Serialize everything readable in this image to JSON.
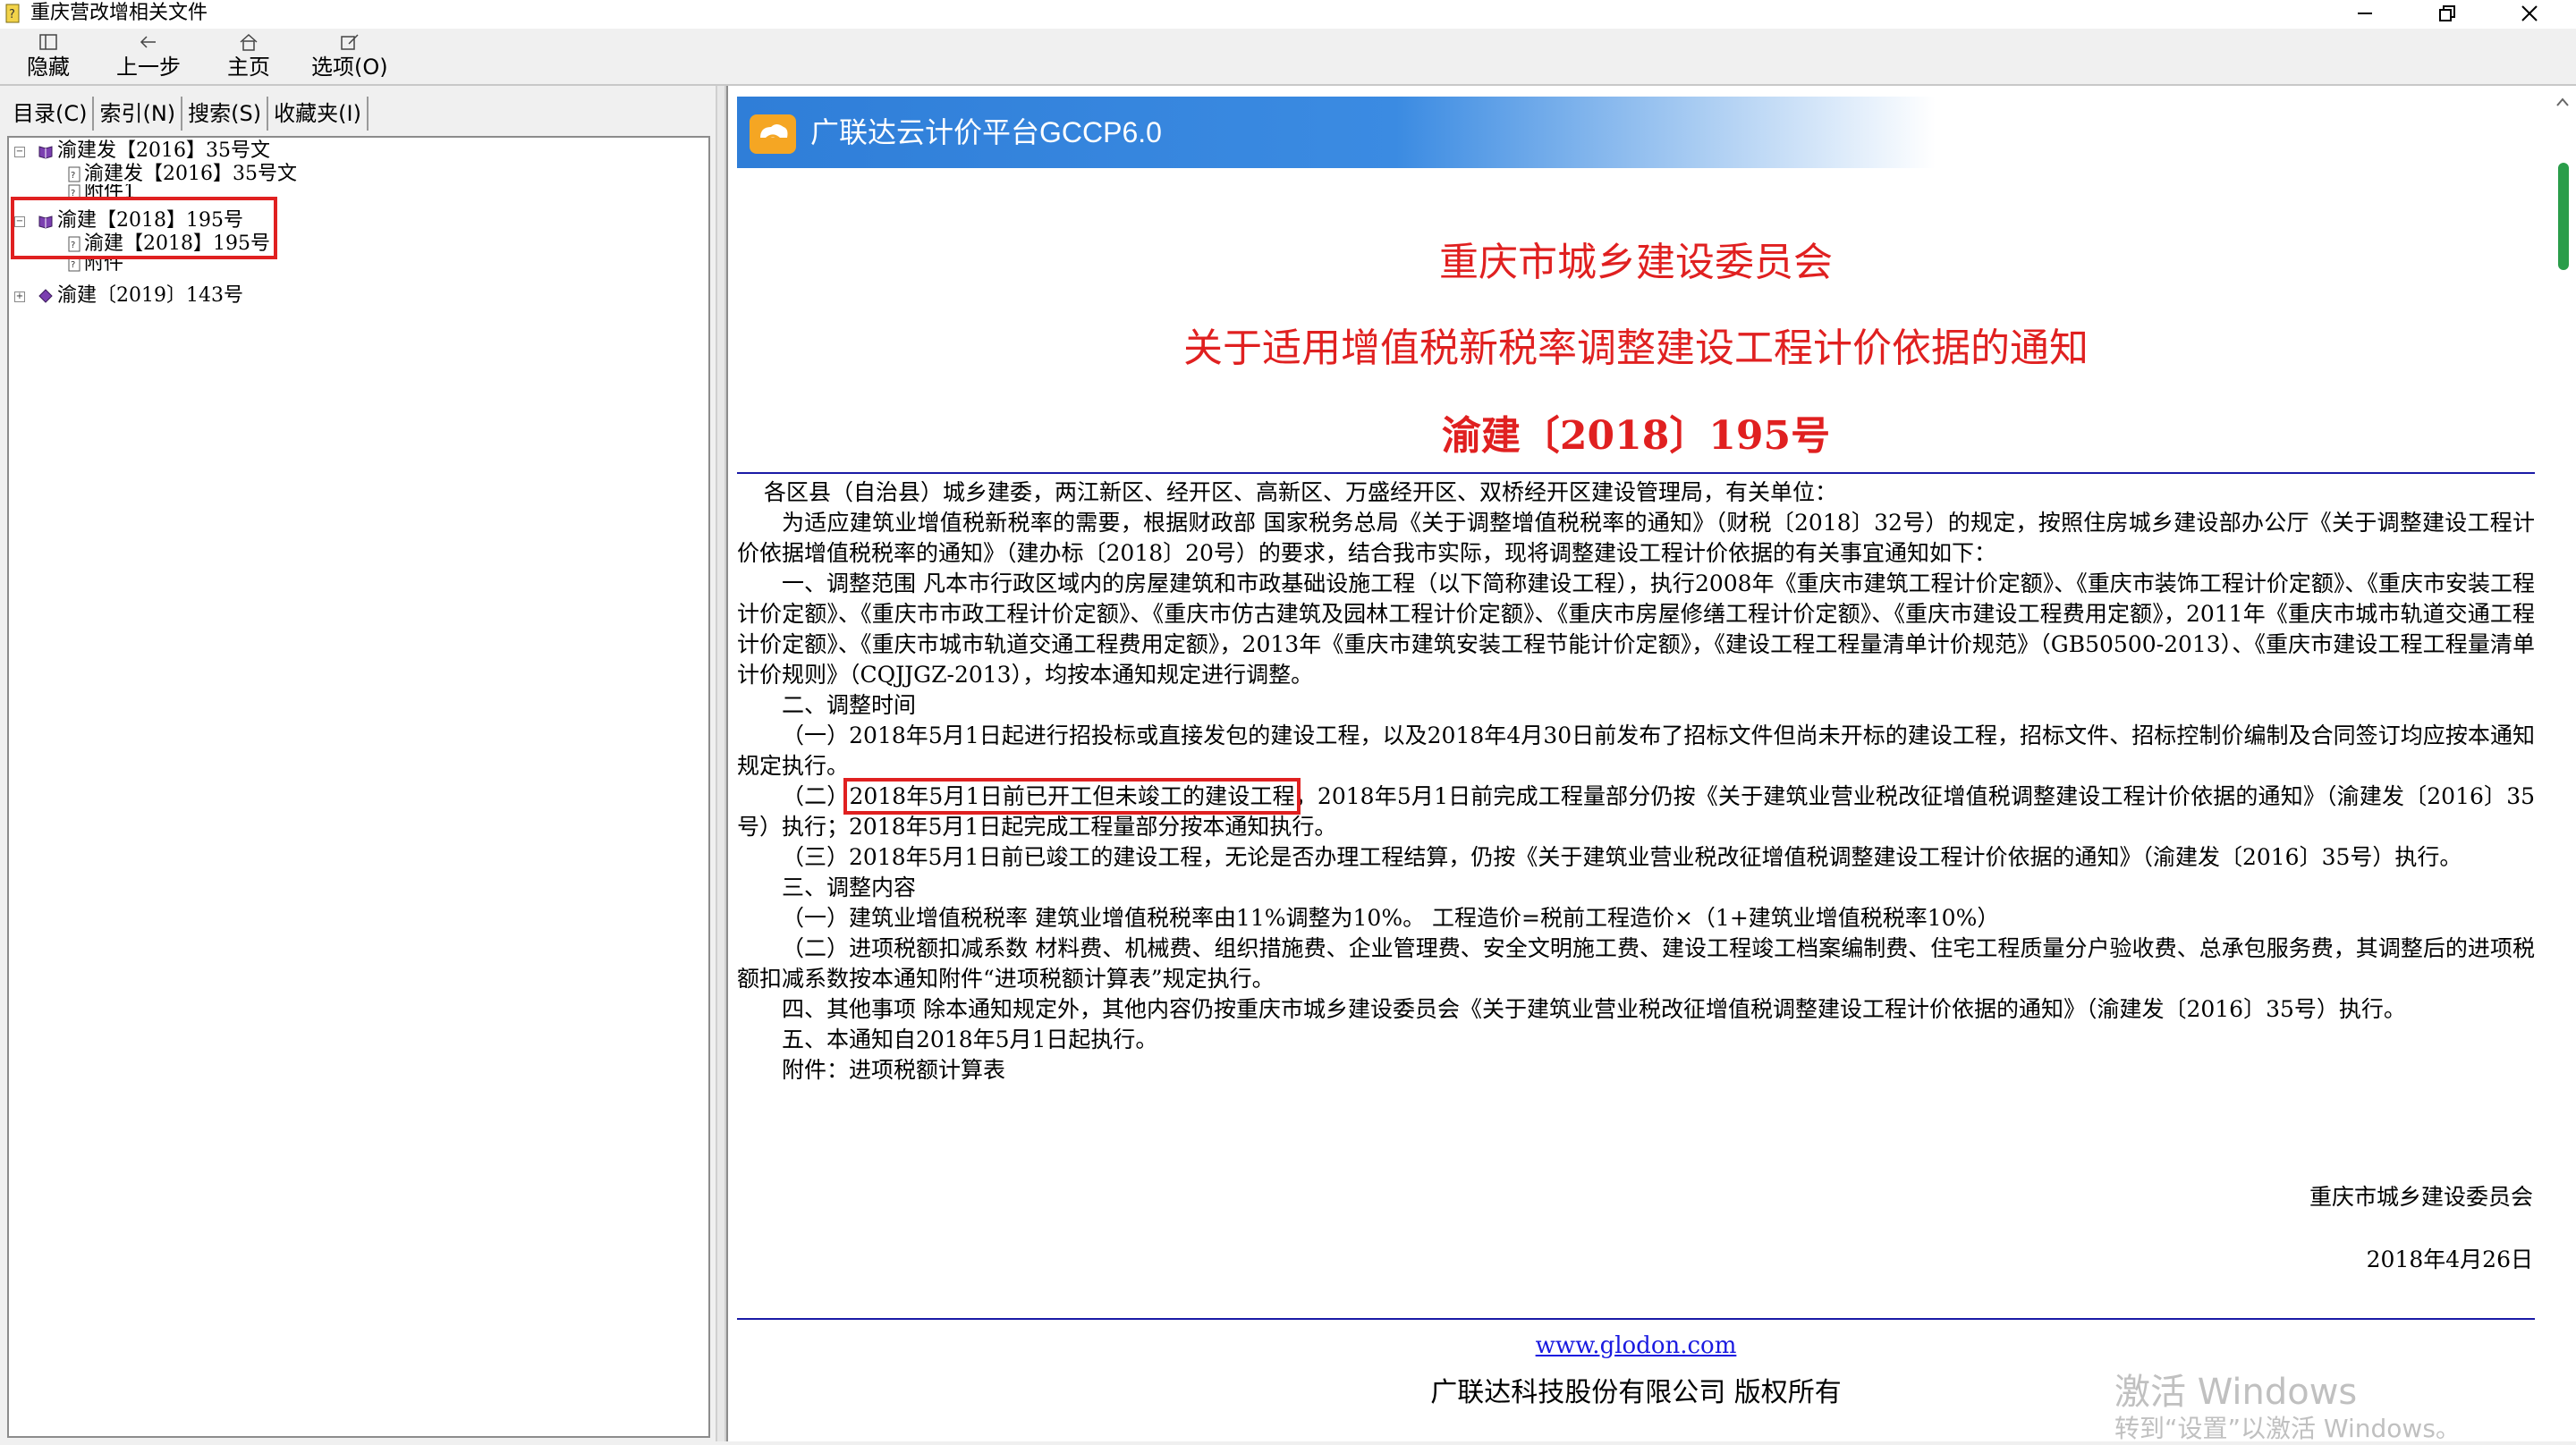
{
  "window": {
    "title": "重庆营改增相关文件",
    "minimize": "—",
    "restore": "❐",
    "close": "✕"
  },
  "toolbar": {
    "hide": "隐藏",
    "back": "上一步",
    "home": "主页",
    "options": "选项(O)"
  },
  "tabs": [
    "目录(C)",
    "索引(N)",
    "搜索(S)",
    "收藏夹(I)"
  ],
  "tree": {
    "n1": "渝建发【2016】35号文",
    "n1_child1": "渝建发【2016】35号文",
    "n1_child2": "附件1",
    "n2": "渝建【2018】195号",
    "n2_child1": "渝建【2018】195号",
    "n2_child2": "附件",
    "n3": "渝建〔2019〕143号"
  },
  "banner": {
    "text": "广联达云计价平台GCCP6.0"
  },
  "doc": {
    "title1": "重庆市城乡建设委员会",
    "title2": "关于适用增值税新税率调整建设工程计价依据的通知",
    "title3": "渝建〔2018〕195号",
    "addressee": "各区县（自治县）城乡建委，两江新区、经开区、高新区、万盛经开区、双桥经开区建设管理局，有关单位：",
    "p1": "为适应建筑业增值税新税率的需要，根据财政部 国家税务总局《关于调整增值税税率的通知》（财税〔2018〕32号）的规定，按照住房城乡建设部办公厅《关于调整建设工程计价依据增值税税率的通知》（建办标〔2018〕20号）的要求，结合我市实际，现将调整建设工程计价依据的有关事宜通知如下：",
    "p2": "一、调整范围 凡本市行政区域内的房屋建筑和市政基础设施工程（以下简称建设工程），执行2008年《重庆市建筑工程计价定额》、《重庆市装饰工程计价定额》、《重庆市安装工程计价定额》、《重庆市市政工程计价定额》、《重庆市仿古建筑及园林工程计价定额》、《重庆市房屋修缮工程计价定额》、《重庆市建设工程费用定额》，2011年《重庆市城市轨道交通工程计价定额》、《重庆市城市轨道交通工程费用定额》，2013年《重庆市建筑安装工程节能计价定额》，《建设工程工程量清单计价规范》（GB50500-2013）、《重庆市建设工程工程量清单计价规则》（CQJJGZ-2013），均按本通知规定进行调整。",
    "p3": "二、调整时间",
    "p4": "（一）2018年5月1日起进行招投标或直接发包的建设工程，以及2018年4月30日前发布了招标文件但尚未开标的建设工程，招标文件、招标控制价编制及合同签订均应按本通知规定执行。",
    "p5_prefix": "（二）",
    "p5_highlight": "2018年5月1日前已开工但未竣工的建设工程",
    "p5_rest": "，2018年5月1日前完成工程量部分仍按《关于建筑业营业税改征增值税调整建设工程计价依据的通知》（渝建发〔2016〕35号）执行；2018年5月1日起完成工程量部分按本通知执行。",
    "p6": "（三）2018年5月1日前已竣工的建设工程，无论是否办理工程结算，仍按《关于建筑业营业税改征增值税调整建设工程计价依据的通知》（渝建发〔2016〕35号）执行。",
    "p7": "三、调整内容",
    "p8": "（一）建筑业增值税税率 建筑业增值税税率由11%调整为10%。 工程造价=税前工程造价×（1+建筑业增值税税率10%）",
    "p9": "（二）进项税额扣减系数 材料费、机械费、组织措施费、企业管理费、安全文明施工费、建设工程竣工档案编制费、住宅工程质量分户验收费、总承包服务费，其调整后的进项税额扣减系数按本通知附件“进项税额计算表”规定执行。",
    "p10": "四、其他事项 除本通知规定外，其他内容仍按重庆市城乡建设委员会《关于建筑业营业税改征增值税调整建设工程计价依据的通知》（渝建发〔2016〕35号）执行。",
    "p11": "五、本通知自2018年5月1日起执行。",
    "p12": "附件：进项税额计算表",
    "signer": "重庆市城乡建设委员会",
    "date": "2018年4月26日",
    "footer_link": "www.glodon.com",
    "footer_copy": "广联达科技股份有限公司 版权所有"
  },
  "watermark": {
    "line1": "激活 Windows",
    "line2": "转到“设置”以激活 Windows。"
  },
  "colors": {
    "accent_red": "#e02020",
    "banner_blue": "#2f7ed8",
    "rule_blue": "#1a1aa6",
    "scroll_green": "#2a9d4a"
  }
}
